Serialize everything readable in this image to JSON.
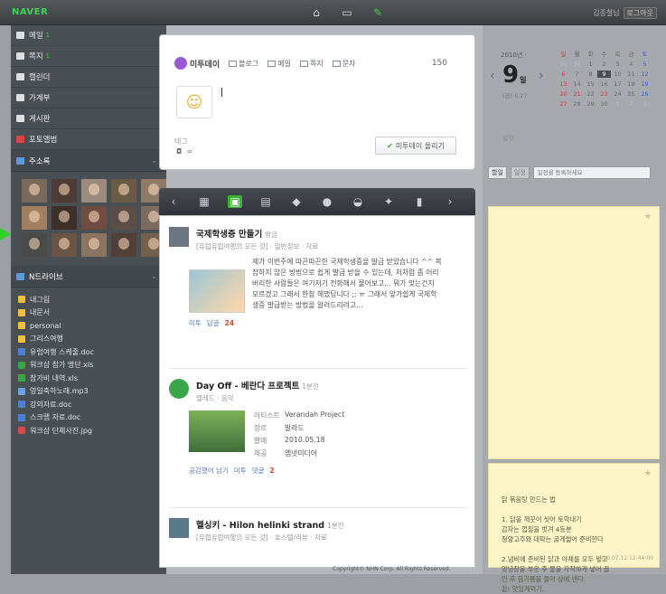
{
  "topbar": {
    "logo": "NAVER",
    "icons": [
      "home-icon",
      "window-icon",
      "note-icon"
    ],
    "user_name": "김종철님",
    "user_button": "로그아웃"
  },
  "sidebar": {
    "items": [
      {
        "label": "메일",
        "badge": "1",
        "icon": "mail-icon"
      },
      {
        "label": "쪽지",
        "badge": "1",
        "icon": "note-icon"
      },
      {
        "label": "캘린더",
        "badge": "",
        "icon": "calendar-icon"
      },
      {
        "label": "가계부",
        "badge": "",
        "icon": "ledger-icon"
      },
      {
        "label": "게시판",
        "badge": "",
        "icon": "board-icon"
      },
      {
        "label": "포토앨범",
        "badge": "",
        "icon": "photo-icon"
      }
    ],
    "contacts_label": "주소록",
    "ndrive_label": "N드라이브",
    "files": [
      {
        "name": "내그림",
        "type": "folder"
      },
      {
        "name": "내문서",
        "type": "folder"
      },
      {
        "name": "personal",
        "type": "folder"
      },
      {
        "name": "그리스여행",
        "type": "folder"
      },
      {
        "name": "유럽여행 스케줄.doc",
        "type": "doc"
      },
      {
        "name": "워크샵 참가 명단.xls",
        "type": "xls"
      },
      {
        "name": "참가비 내역.xls",
        "type": "xls"
      },
      {
        "name": "영일축하노래.mp3",
        "type": "mp3"
      },
      {
        "name": "강의자료.doc",
        "type": "doc"
      },
      {
        "name": "스크랩 자료.doc",
        "type": "doc"
      },
      {
        "name": "워크샵 단체사진.jpg",
        "type": "jpg"
      }
    ]
  },
  "compose": {
    "brand": "미투데이",
    "tabs": [
      "블로그",
      "메일",
      "쪽지",
      "문자"
    ],
    "char_count": "150",
    "bottom_label": "태그",
    "post_button": "미투데이 올리기"
  },
  "toolbar": {
    "icons": [
      "prev-icon",
      "calendar-icon",
      "notebook-icon",
      "chat-icon",
      "cafe-icon",
      "pin-icon",
      "cup-icon",
      "paw-icon",
      "bookmark-icon",
      "next-icon"
    ]
  },
  "feed": {
    "post1": {
      "title": "국제학생증 만들기",
      "time": "방금",
      "meta": "[유럽유럽여행의 모든 것] · 일반정보 · 자료",
      "body": "제가 이번주에 따끈따끈한 국제학생증을 발급 받았습니다 ^^ 복잡하지 않은 방법으로 쉽게 발급 받을 수 있는데, 처처럼 좀 어리버리한 사람들은 여기저기 전화해서 물어보고... 뭐가 맞는건지 모르겠고 그래서 한참 헤맸답니다 ;; ㅠ 그래서 앞가쉽게 국제학생증 발급받는 방법을 알려드리려고...",
      "actions": [
        "미투",
        "담글"
      ],
      "comment_count": "24"
    },
    "post2": {
      "title": "Day Off - 베란다 프로젝트",
      "time": "1분전",
      "meta": "앨레드 · 음악",
      "fields": [
        {
          "k": "아티스트",
          "v": "Verandah Project"
        },
        {
          "k": "장르",
          "v": "발라드"
        },
        {
          "k": "발매",
          "v": "2010.05.18"
        },
        {
          "k": "제공",
          "v": "엠넷미디어"
        }
      ],
      "actions": [
        "공감했어 남기",
        "미투",
        "댓글"
      ],
      "comment_count": "2"
    },
    "post3": {
      "title": "헬싱키 - Hilon helinki strand",
      "time": "1분전",
      "meta": "[유럽유럽여행의 모든 것] · 호스텔/리뷰 · 자료"
    }
  },
  "calendar": {
    "header": "2010년 · ",
    "day": "9",
    "day_suffix": "일",
    "sub": "(금) 6.27",
    "weekdays": [
      "일",
      "월",
      "화",
      "수",
      "목",
      "금",
      "토"
    ],
    "rows": [
      [
        "30",
        "31",
        "1",
        "2",
        "3",
        "4",
        "5"
      ],
      [
        "6",
        "7",
        "8",
        "9",
        "10",
        "11",
        "12"
      ],
      [
        "13",
        "14",
        "15",
        "16",
        "17",
        "18",
        "19"
      ],
      [
        "20",
        "21",
        "22",
        "23",
        "24",
        "25",
        "26"
      ],
      [
        "27",
        "28",
        "29",
        "30",
        "1",
        "2",
        "3"
      ]
    ],
    "bottom": "일정",
    "tabs": [
      "할일",
      "일정"
    ],
    "search_placeholder": "일정을 등록하세요"
  },
  "notes": {
    "note2_text": "닭 볶음탕 만드는 법\n\n1. 닭을 깨끗이 씻어 토막내기\n감자는 껍질을 벗겨 4등분\n청양고추와 대파는 굵게썰어 준비한다\n\n2.냄비에 준비된 닭과 야채를 모두 넣고\n양념장을 부운 후 물을 자작하게 넣어 끓\n인 후 참기름을 둘러 상에 낸다.\n끝! 맛있게먹기.",
    "note2_date": "2010.07.12 12:44:00"
  },
  "footer": "Copyright© NHN Corp. All Rights Reserved.",
  "colors": {
    "accent": "#39b436",
    "sidebar": "#4a4f54",
    "note": "#fbf5c8"
  }
}
